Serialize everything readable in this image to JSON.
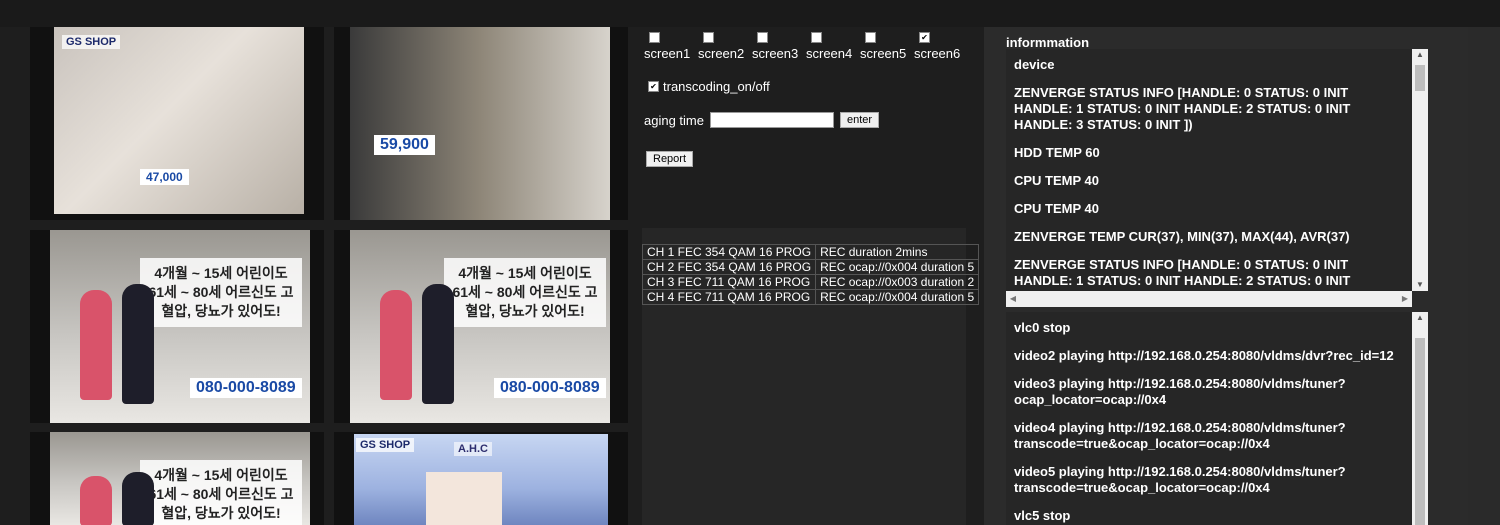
{
  "screens": [
    {
      "label": "screen1",
      "checked": false
    },
    {
      "label": "screen2",
      "checked": false
    },
    {
      "label": "screen3",
      "checked": false
    },
    {
      "label": "screen4",
      "checked": false
    },
    {
      "label": "screen5",
      "checked": false
    },
    {
      "label": "screen6",
      "checked": true
    }
  ],
  "transcoding": {
    "label": "transcoding_on/off",
    "checked": true
  },
  "aging": {
    "label": "aging time",
    "value": "",
    "enter_label": "enter"
  },
  "report_label": "Report",
  "channels": [
    {
      "col1": "CH 1 FEC 354 QAM 16 PROG",
      "col2": "REC  duration 2mins"
    },
    {
      "col1": "CH 2 FEC 354 QAM 16 PROG",
      "col2": "REC ocap://0x004 duration 5"
    },
    {
      "col1": "CH 3 FEC 711 QAM 16 PROG",
      "col2": "REC ocap://0x003 duration 2"
    },
    {
      "col1": "CH 4 FEC 711 QAM 16 PROG",
      "col2": "REC ocap://0x004 duration 5"
    }
  ],
  "info": {
    "title": "informmation",
    "device_log": [
      "device",
      "ZENVERGE STATUS INFO [HANDLE: 0 STATUS: 0 INIT HANDLE: 1 STATUS: 0 INIT HANDLE: 2 STATUS: 0 INIT HANDLE: 3 STATUS: 0 INIT ])",
      "HDD TEMP 60",
      "CPU TEMP 40",
      "CPU TEMP 40",
      "ZENVERGE TEMP CUR(37), MIN(37), MAX(44), AVR(37)",
      "ZENVERGE STATUS INFO [HANDLE: 0 STATUS: 0 INIT HANDLE: 1 STATUS: 0 INIT HANDLE: 2 STATUS: 0 INIT"
    ],
    "vlc_log": [
      "vlc0 stop",
      "video2 playing http://192.168.0.254:8080/vldms/dvr?rec_id=12",
      "video3 playing http://192.168.0.254:8080/vldms/tuner?ocap_locator=ocap://0x4",
      "video4 playing http://192.168.0.254:8080/vldms/tuner?transcode=true&ocap_locator=ocap://0x4",
      "video5 playing http://192.168.0.254:8080/vldms/tuner?transcode=true&ocap_locator=ocap://0x4",
      "vlc5 stop"
    ]
  },
  "video_text": {
    "t1_caption": "GS SHOP",
    "t1_prices": "47,000",
    "t2_price": "59,900",
    "t3_text": "4개월 ~ 15세 어린이도 61세 ~ 80세 어르신도 고혈압, 당뇨가 있어도!",
    "t3_phone": "080-000-8089",
    "t6_logo": "A.H.C"
  }
}
